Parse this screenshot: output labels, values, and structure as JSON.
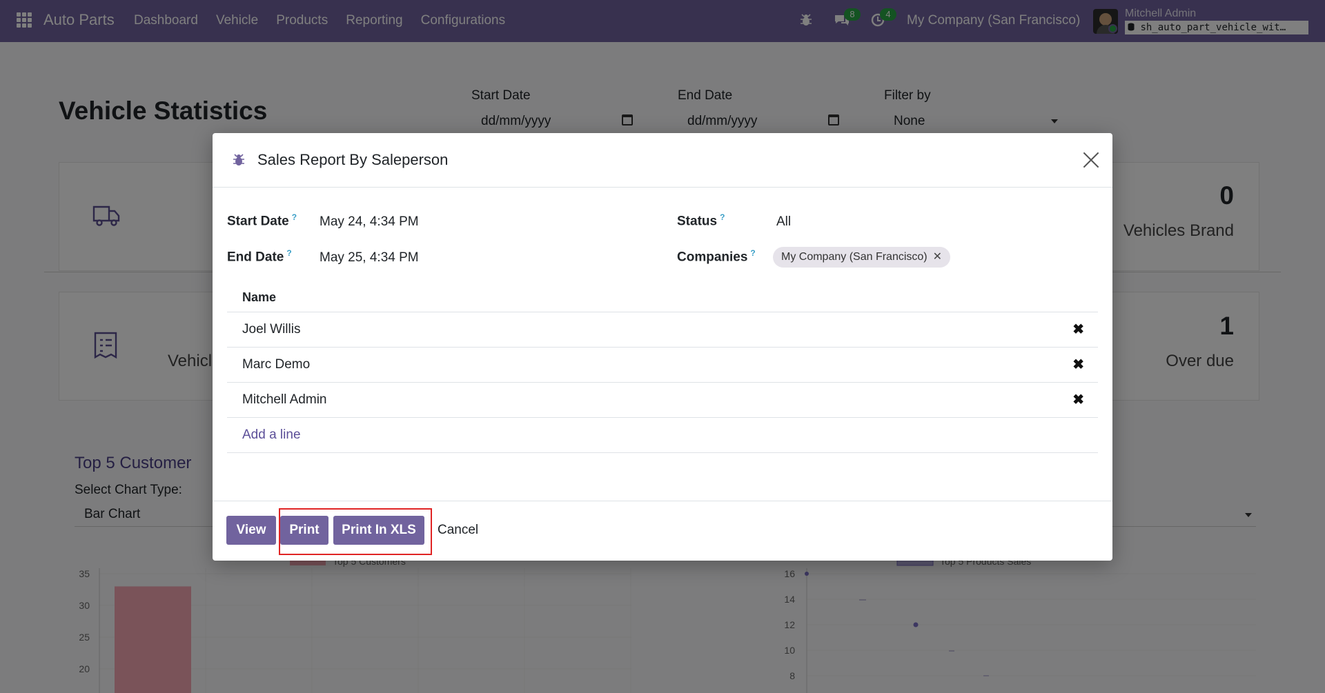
{
  "navbar": {
    "brand": "Auto Parts",
    "menu": [
      "Dashboard",
      "Vehicle",
      "Products",
      "Reporting",
      "Configurations"
    ],
    "messages_count": "8",
    "activities_count": "4",
    "company": "My Company (San Francisco)",
    "user": "Mitchell Admin",
    "database": "sh_auto_part_vehicle_wit…"
  },
  "page": {
    "title": "Vehicle Statistics",
    "start_date_label": "Start Date",
    "start_date_value": "dd/mm/yyyy",
    "end_date_label": "End Date",
    "end_date_value": "dd/mm/yyyy",
    "filter_label": "Filter by",
    "filter_value": "None",
    "stats": [
      {
        "value": "0",
        "label": "Vehicles Brand"
      },
      {
        "value": "1",
        "label": "Over due"
      }
    ],
    "partial_label": "Vehicl",
    "top_customer_title": "Top 5 Customer",
    "chart_type_label": "Select Chart Type:",
    "chart_type_value": "Bar Chart"
  },
  "chart_data": [
    {
      "type": "bar",
      "title": "",
      "legend": "Top 5 Customers",
      "y_ticks": [
        "35",
        "30",
        "25",
        "20"
      ],
      "values": [
        33
      ]
    },
    {
      "type": "scatter",
      "title": "",
      "legend": "Top 5 Products Sales",
      "y_ticks": [
        "16",
        "14",
        "12",
        "10",
        "8"
      ]
    }
  ],
  "modal": {
    "title": "Sales Report By Saleperson",
    "start_date_label": "Start Date",
    "start_date_value": "May 24, 4:34 PM",
    "end_date_label": "End Date",
    "end_date_value": "May 25, 4:34 PM",
    "status_label": "Status",
    "status_value": "All",
    "companies_label": "Companies",
    "company_tag": "My Company (San Francisco)",
    "help_mark": "?",
    "table_header": "Name",
    "rows": [
      "Joel Willis",
      "Marc Demo",
      "Mitchell Admin"
    ],
    "add_line": "Add a line",
    "buttons": {
      "view": "View",
      "print": "Print",
      "print_xls": "Print In XLS",
      "cancel": "Cancel"
    }
  },
  "colors": {
    "navbar": "#71639e",
    "primary_button": "#71639e",
    "highlight": "#e02424",
    "badge": "#28a745"
  }
}
